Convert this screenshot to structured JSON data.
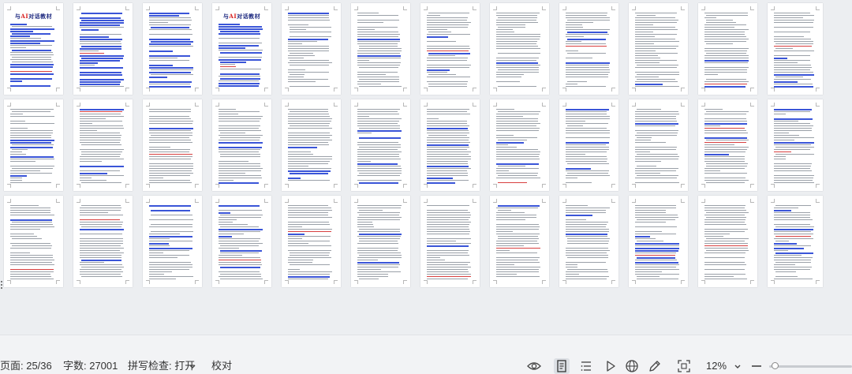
{
  "document": {
    "cover_title_prefix": "与",
    "cover_title_ai": "AI",
    "cover_title_suffix": "对话教材"
  },
  "statusbar": {
    "page_indicator": "页面: 25/36",
    "word_count": "字数: 27001",
    "spell_check": "拼写检查: 打开",
    "proofread": "校对",
    "zoom_level": "12%"
  },
  "icons": {
    "spell_dropdown": "chevron-down-icon",
    "reading_mode": "eye-icon",
    "page_view": "page-view-icon",
    "outline_view": "outline-list-icon",
    "play": "play-icon",
    "web_view": "globe-icon",
    "pen": "pen-icon",
    "fit_screen": "fit-screen-icon",
    "zoom_dropdown": "chevron-down-icon",
    "zoom_out": "minus-icon"
  },
  "colors": {
    "canvas_bg": "#eceef1",
    "page_bg": "#ffffff",
    "heading_blue": "#3a55d8",
    "accent_red": "#d84040"
  }
}
